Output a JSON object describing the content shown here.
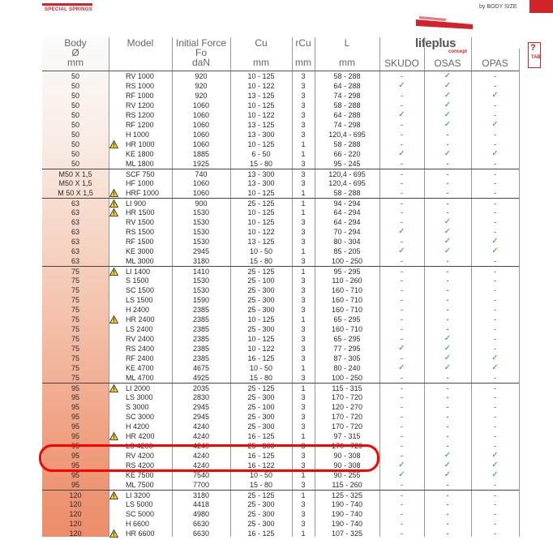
{
  "header": {
    "logo_text": "SPECIAL SPRINGS",
    "by_body_size": "by BODY SIZE",
    "brand_name": "lifeplus",
    "brand_sub": "concept",
    "tab_q": "?",
    "tab_label": "TAB"
  },
  "columns": {
    "body": [
      "Body",
      "Ø",
      "mm"
    ],
    "model": [
      "Model"
    ],
    "force": [
      "Initial Force",
      "Fo",
      "daN"
    ],
    "cu": [
      "Cu",
      "",
      "mm"
    ],
    "rcu": [
      "rCu",
      "",
      "mm"
    ],
    "l": [
      "L",
      "",
      "mm"
    ],
    "skudo": "SKUDO",
    "osas": "OSAS",
    "opas": "OPAS"
  },
  "symbols": {
    "check": "✓",
    "dash": "-",
    "warn": "⚠"
  },
  "rows": [
    {
      "body": "50",
      "model": "RV 1000",
      "warn": false,
      "force": "920",
      "cu": "10 - 125",
      "rcu": "3",
      "l": "58 - 288",
      "sk": "-",
      "os": "✓",
      "op": "-"
    },
    {
      "body": "50",
      "model": "RS 1000",
      "warn": false,
      "force": "920",
      "cu": "10 - 122",
      "rcu": "3",
      "l": "64 - 288",
      "sk": "✓",
      "os": "✓",
      "op": "-"
    },
    {
      "body": "50",
      "model": "RF 1000",
      "warn": false,
      "force": "920",
      "cu": "13 - 125",
      "rcu": "3",
      "l": "74 - 298",
      "sk": "-",
      "os": "✓",
      "op": "✓"
    },
    {
      "body": "50",
      "model": "RV 1200",
      "warn": false,
      "force": "1060",
      "cu": "10 - 125",
      "rcu": "3",
      "l": "58 - 288",
      "sk": "-",
      "os": "✓",
      "op": "-"
    },
    {
      "body": "50",
      "model": "RS 1200",
      "warn": false,
      "force": "1060",
      "cu": "10 - 122",
      "rcu": "3",
      "l": "64 - 288",
      "sk": "✓",
      "os": "✓",
      "op": "-"
    },
    {
      "body": "50",
      "model": "RF 1200",
      "warn": false,
      "force": "1060",
      "cu": "13 - 125",
      "rcu": "3",
      "l": "74 - 298",
      "sk": "-",
      "os": "✓",
      "op": "✓"
    },
    {
      "body": "50",
      "model": "H 1000",
      "warn": false,
      "force": "1060",
      "cu": "13 - 300",
      "rcu": "3",
      "l": "120,4 - 695",
      "sk": "-",
      "os": "-",
      "op": "-"
    },
    {
      "body": "50",
      "model": "HR 1000",
      "warn": true,
      "force": "1060",
      "cu": "10 - 125",
      "rcu": "1",
      "l": "58 - 288",
      "sk": "-",
      "os": "-",
      "op": "-"
    },
    {
      "body": "50",
      "model": "KE 1800",
      "warn": false,
      "force": "1885",
      "cu": "6 - 50",
      "rcu": "1",
      "l": "66 - 220",
      "sk": "✓",
      "os": "✓",
      "op": "✓"
    },
    {
      "body": "50",
      "model": "ML 1800",
      "warn": false,
      "force": "1925",
      "cu": "15 - 80",
      "rcu": "3",
      "l": "95 - 245",
      "sk": "-",
      "os": "-",
      "op": "-"
    },
    {
      "body": "M50 X 1,5",
      "model": "SCF 750",
      "warn": false,
      "force": "740",
      "cu": "13 - 300",
      "rcu": "3",
      "l": "120,4 - 695",
      "sk": "-",
      "os": "-",
      "op": "-",
      "sep": true
    },
    {
      "body": "M50 X 1,5",
      "model": "HF 1000",
      "warn": false,
      "force": "1060",
      "cu": "13 - 300",
      "rcu": "3",
      "l": "120,4 - 695",
      "sk": "-",
      "os": "-",
      "op": "-"
    },
    {
      "body": "M 50 X 1,5",
      "model": "HRF 1000",
      "warn": true,
      "force": "1060",
      "cu": "10 - 125",
      "rcu": "1",
      "l": "58 - 288",
      "sk": "-",
      "os": "-",
      "op": "-"
    },
    {
      "body": "63",
      "model": "LI 900",
      "warn": true,
      "force": "900",
      "cu": "25 - 125",
      "rcu": "1",
      "l": "94 - 294",
      "sk": "-",
      "os": "-",
      "op": "-",
      "sep": true
    },
    {
      "body": "63",
      "model": "HR 1500",
      "warn": true,
      "force": "1530",
      "cu": "10 - 125",
      "rcu": "1",
      "l": "64 - 294",
      "sk": "-",
      "os": "-",
      "op": "-"
    },
    {
      "body": "63",
      "model": "RV 1500",
      "warn": false,
      "force": "1530",
      "cu": "10 - 125",
      "rcu": "3",
      "l": "64 - 294",
      "sk": "-",
      "os": "✓",
      "op": "-"
    },
    {
      "body": "63",
      "model": "RS 1500",
      "warn": false,
      "force": "1530",
      "cu": "10 - 122",
      "rcu": "3",
      "l": "70 - 294",
      "sk": "✓",
      "os": "✓",
      "op": "-"
    },
    {
      "body": "63",
      "model": "RF 1500",
      "warn": false,
      "force": "1530",
      "cu": "13 - 125",
      "rcu": "3",
      "l": "80 - 304",
      "sk": "-",
      "os": "✓",
      "op": "✓"
    },
    {
      "body": "63",
      "model": "KE 3000",
      "warn": false,
      "force": "2945",
      "cu": "10 - 50",
      "rcu": "1",
      "l": "85 - 205",
      "sk": "✓",
      "os": "✓",
      "op": "✓"
    },
    {
      "body": "63",
      "model": "ML 3000",
      "warn": false,
      "force": "3180",
      "cu": "15 - 80",
      "rcu": "3",
      "l": "100 - 250",
      "sk": "-",
      "os": "-",
      "op": "-"
    },
    {
      "body": "75",
      "model": "LI 1400",
      "warn": true,
      "force": "1410",
      "cu": "25 - 125",
      "rcu": "1",
      "l": "95 - 295",
      "sk": "-",
      "os": "-",
      "op": "-",
      "sep": true
    },
    {
      "body": "75",
      "model": "S 1500",
      "warn": false,
      "force": "1530",
      "cu": "25 - 100",
      "rcu": "3",
      "l": "110 - 260",
      "sk": "-",
      "os": "-",
      "op": "-"
    },
    {
      "body": "75",
      "model": "SC 1500",
      "warn": false,
      "force": "1530",
      "cu": "25 - 300",
      "rcu": "3",
      "l": "160 - 710",
      "sk": "-",
      "os": "-",
      "op": "-"
    },
    {
      "body": "75",
      "model": "LS 1500",
      "warn": false,
      "force": "1590",
      "cu": "25 - 300",
      "rcu": "3",
      "l": "160 - 710",
      "sk": "-",
      "os": "-",
      "op": "-"
    },
    {
      "body": "75",
      "model": "H 2400",
      "warn": false,
      "force": "2385",
      "cu": "25 - 300",
      "rcu": "3",
      "l": "160 - 710",
      "sk": "-",
      "os": "-",
      "op": "-"
    },
    {
      "body": "75",
      "model": "HR 2400",
      "warn": true,
      "force": "2385",
      "cu": "10 - 125",
      "rcu": "1",
      "l": "65 - 295",
      "sk": "-",
      "os": "-",
      "op": "-"
    },
    {
      "body": "75",
      "model": "LS 2400",
      "warn": false,
      "force": "2385",
      "cu": "25 - 300",
      "rcu": "3",
      "l": "160 - 710",
      "sk": "-",
      "os": "-",
      "op": "-"
    },
    {
      "body": "75",
      "model": "RV 2400",
      "warn": false,
      "force": "2385",
      "cu": "10 - 125",
      "rcu": "3",
      "l": "65 - 295",
      "sk": "-",
      "os": "✓",
      "op": "-"
    },
    {
      "body": "75",
      "model": "RS 2400",
      "warn": false,
      "force": "2385",
      "cu": "10 - 122",
      "rcu": "3",
      "l": "77 - 295",
      "sk": "✓",
      "os": "✓",
      "op": "-"
    },
    {
      "body": "75",
      "model": "RF 2400",
      "warn": false,
      "force": "2385",
      "cu": "16 - 125",
      "rcu": "3",
      "l": "87 - 305",
      "sk": "-",
      "os": "✓",
      "op": "✓"
    },
    {
      "body": "75",
      "model": "KE 4700",
      "warn": false,
      "force": "4675",
      "cu": "10 - 50",
      "rcu": "1",
      "l": "80 - 240",
      "sk": "✓",
      "os": "✓",
      "op": "✓"
    },
    {
      "body": "75",
      "model": "ML 4700",
      "warn": false,
      "force": "4925",
      "cu": "15 - 80",
      "rcu": "3",
      "l": "100 - 250",
      "sk": "-",
      "os": "-",
      "op": "-"
    },
    {
      "body": "95",
      "model": "LI 2000",
      "warn": true,
      "force": "2035",
      "cu": "25 - 125",
      "rcu": "1",
      "l": "115 - 315",
      "sk": "-",
      "os": "-",
      "op": "-",
      "sep": true
    },
    {
      "body": "95",
      "model": "LS 3000",
      "warn": false,
      "force": "2830",
      "cu": "25 - 300",
      "rcu": "3",
      "l": "170 - 720",
      "sk": "-",
      "os": "-",
      "op": "-"
    },
    {
      "body": "95",
      "model": "S 3000",
      "warn": false,
      "force": "2945",
      "cu": "25 - 100",
      "rcu": "3",
      "l": "120 - 270",
      "sk": "-",
      "os": "-",
      "op": "-"
    },
    {
      "body": "95",
      "model": "SC 3000",
      "warn": false,
      "force": "2945",
      "cu": "25 - 300",
      "rcu": "3",
      "l": "170 - 720",
      "sk": "-",
      "os": "-",
      "op": "-"
    },
    {
      "body": "95",
      "model": "H 4200",
      "warn": false,
      "force": "4240",
      "cu": "25 - 300",
      "rcu": "3",
      "l": "170 - 720",
      "sk": "-",
      "os": "-",
      "op": "-"
    },
    {
      "body": "95",
      "model": "HR 4200",
      "warn": true,
      "force": "4240",
      "cu": "16 - 125",
      "rcu": "1",
      "l": "97 - 315",
      "sk": "-",
      "os": "-",
      "op": "-"
    },
    {
      "body": "95",
      "model": "LS 4200",
      "warn": false,
      "force": "4240",
      "cu": "25 - 300",
      "rcu": "3",
      "l": "170 - 720",
      "sk": "-",
      "os": "-",
      "op": "-"
    },
    {
      "body": "95",
      "model": "RV 4200",
      "warn": false,
      "force": "4240",
      "cu": "16 - 125",
      "rcu": "3",
      "l": "90 - 308",
      "sk": "-",
      "os": "✓",
      "op": "✓",
      "highlight": true
    },
    {
      "body": "95",
      "model": "RS 4200",
      "warn": false,
      "force": "4240",
      "cu": "16 - 122",
      "rcu": "3",
      "l": "90 - 308",
      "sk": "✓",
      "os": "✓",
      "op": "✓"
    },
    {
      "body": "95",
      "model": "KE 7500",
      "warn": false,
      "force": "7540",
      "cu": "10 - 50",
      "rcu": "1",
      "l": "90 - 255",
      "sk": "✓",
      "os": "✓",
      "op": "✓"
    },
    {
      "body": "95",
      "model": "ML 7500",
      "warn": false,
      "force": "7700",
      "cu": "15 - 80",
      "rcu": "3",
      "l": "115 - 260",
      "sk": "-",
      "os": "-",
      "op": "-"
    },
    {
      "body": "120",
      "model": "LI 3200",
      "warn": true,
      "force": "3180",
      "cu": "25 - 125",
      "rcu": "1",
      "l": "125 - 325",
      "sk": "-",
      "os": "-",
      "op": "-",
      "sep": true
    },
    {
      "body": "120",
      "model": "LS 5000",
      "warn": false,
      "force": "4418",
      "cu": "25 - 300",
      "rcu": "3",
      "l": "190 - 740",
      "sk": "-",
      "os": "-",
      "op": "-"
    },
    {
      "body": "120",
      "model": "SC 5000",
      "warn": false,
      "force": "4980",
      "cu": "25 - 300",
      "rcu": "3",
      "l": "190 - 740",
      "sk": "-",
      "os": "-",
      "op": "-"
    },
    {
      "body": "120",
      "model": "H 6600",
      "warn": false,
      "force": "6630",
      "cu": "25 - 300",
      "rcu": "3",
      "l": "190 - 740",
      "sk": "-",
      "os": "-",
      "op": "-"
    },
    {
      "body": "120",
      "model": "HR 6600",
      "warn": true,
      "force": "6630",
      "cu": "16 - 125",
      "rcu": "1",
      "l": "107 - 325",
      "sk": "-",
      "os": "-",
      "op": "-"
    }
  ]
}
